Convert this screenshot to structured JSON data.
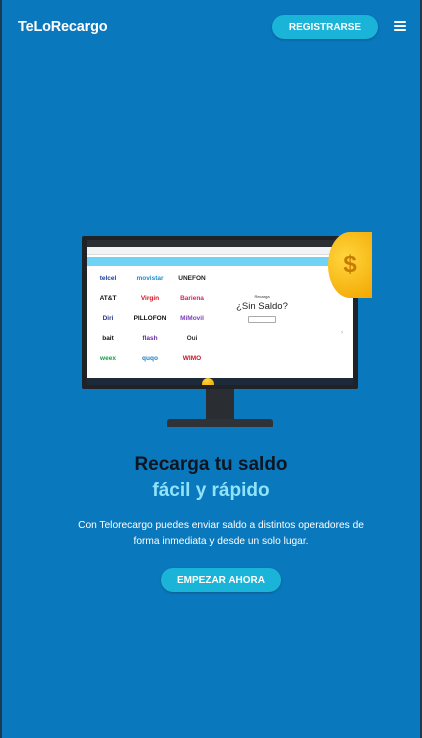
{
  "header": {
    "brand": "TeLoRecargo",
    "register_label": "REGISTRARSE",
    "menu_icon": "hamburger-menu-icon"
  },
  "hero": {
    "title": "Recarga tu saldo",
    "subtitle": "fácil y rápido",
    "description": "Con Telorecargo puedes enviar saldo a distintos operadores de forma inmediata y desde un solo lugar.",
    "cta_label": "EMPEZAR AHORA"
  },
  "illustration": {
    "operator_logos": [
      [
        "telcel",
        "movistar",
        "UNEFON"
      ],
      [
        "AT&T",
        "Virgin",
        "Bariena"
      ],
      [
        "Diri",
        "PILLOFON",
        "MiMovil"
      ],
      [
        "bait",
        "flash",
        "Oui"
      ],
      [
        "weex",
        "quqo",
        "WIMO"
      ]
    ],
    "promo_kicker": "Recarga",
    "promo_title": "¿Sin Saldo?",
    "coin_symbol": "$"
  },
  "colors": {
    "background": "#0a78bd",
    "accent": "#19b4d8",
    "title": "#0b1622",
    "subtitle": "#8fe3fb"
  }
}
